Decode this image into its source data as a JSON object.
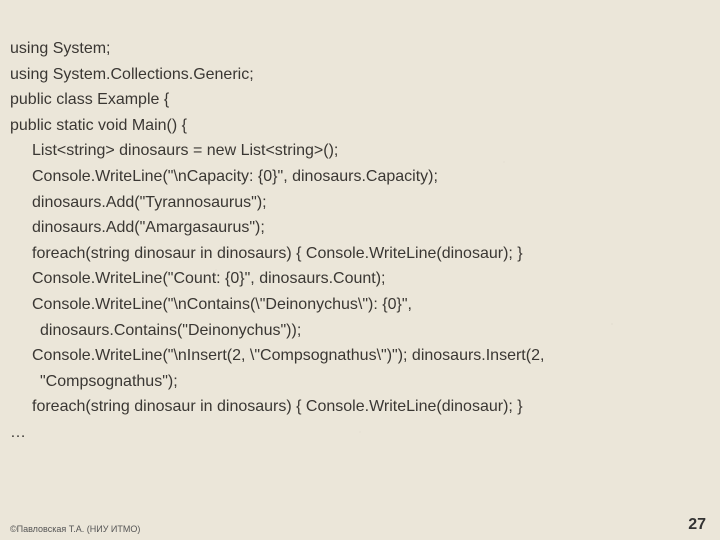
{
  "code": {
    "l0": "using System;",
    "l1": "using System.Collections.Generic;",
    "l2": "public class Example {",
    "l3": "public static void Main() {",
    "l4": "List<string> dinosaurs = new List<string>();",
    "l5": "Console.WriteLine(\"\\nCapacity: {0}\", dinosaurs.Capacity);",
    "l6": "dinosaurs.Add(\"Tyrannosaurus\");",
    "l7": "dinosaurs.Add(\"Amargasaurus\");",
    "l8": "foreach(string dinosaur in dinosaurs) { Console.WriteLine(dinosaur); }",
    "l9": "Console.WriteLine(\"Count: {0}\", dinosaurs.Count);",
    "l10": "Console.WriteLine(\"\\nContains(\\\"Deinonychus\\\"): {0}\",",
    "l10b": "dinosaurs.Contains(\"Deinonychus\"));",
    "l11": "Console.WriteLine(\"\\nInsert(2, \\\"Compsognathus\\\")\"); dinosaurs.Insert(2,",
    "l11b": "\"Compsognathus\");",
    "l12": "foreach(string dinosaur in dinosaurs) { Console.WriteLine(dinosaur); }",
    "l13": "…"
  },
  "footer": {
    "author": "©Павловская Т.А. (НИУ ИТМО)",
    "page": "27"
  }
}
